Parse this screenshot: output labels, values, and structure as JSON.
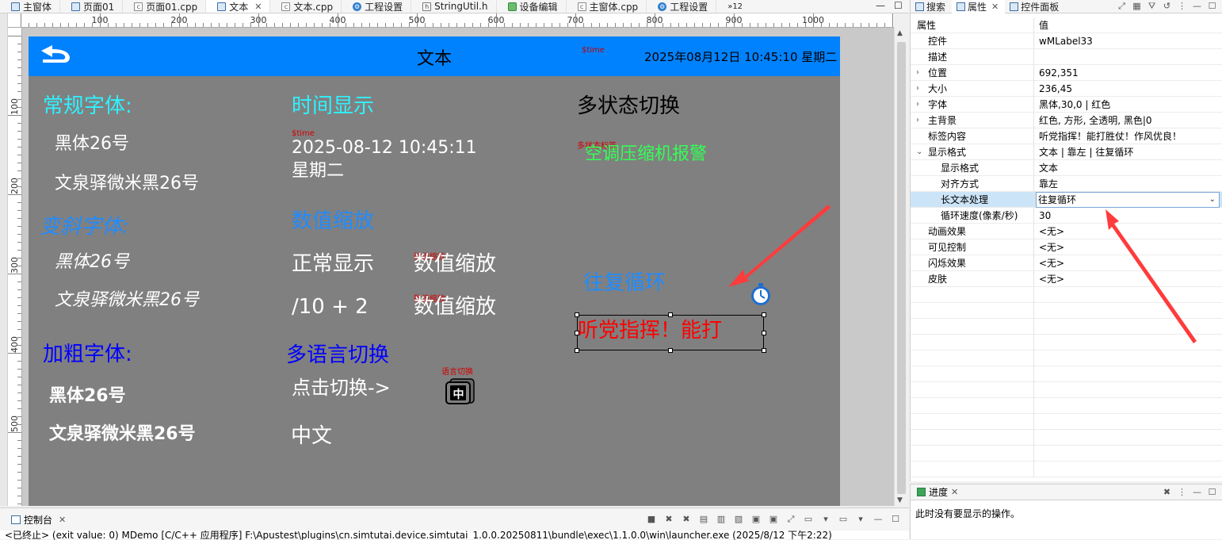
{
  "editor_tabs": [
    {
      "label": "主窗体",
      "icon": "window-icon"
    },
    {
      "label": "页面01",
      "icon": "window-icon"
    },
    {
      "label": "页面01.cpp",
      "icon": "cpp-file-icon"
    },
    {
      "label": "文本",
      "icon": "window-icon",
      "active": true
    },
    {
      "label": "文本.cpp",
      "icon": "cpp-file-icon"
    },
    {
      "label": "工程设置",
      "icon": "gear-icon"
    },
    {
      "label": "StringUtil.h",
      "icon": "header-file-icon"
    },
    {
      "label": "设备编辑",
      "icon": "device-icon"
    },
    {
      "label": "主窗体.cpp",
      "icon": "cpp-file-icon"
    },
    {
      "label": "工程设置",
      "icon": "gear-icon"
    }
  ],
  "tab_overflow": "»12",
  "ruler": {
    "h_labels": [
      "100",
      "200",
      "300",
      "400",
      "500",
      "600",
      "700",
      "800",
      "900",
      "1000"
    ],
    "v_labels": [
      "100",
      "200",
      "300",
      "400",
      "500"
    ]
  },
  "screen": {
    "title": "文本",
    "time_tag": "$time",
    "clock": "2025年08月12日 10:45:10 星期二",
    "col1": {
      "regular_heading": "常规字体:",
      "regular_1": "黑体26号",
      "regular_2": "文泉驿微米黑26号",
      "italic_heading": "变斜字体:",
      "italic_1": "黑体26号",
      "italic_2": "文泉驿微米黑26号",
      "bold_heading": "加粗字体:",
      "bold_1": "黑体26号",
      "bold_2": "文泉驿微米黑26号"
    },
    "col2": {
      "time_heading": "时间显示",
      "time_tag": "$time",
      "date_line": "2025-08-12 10:45:11",
      "weekday_line": "星期二",
      "scale_heading": "数值缩放",
      "normal_label": "正常显示",
      "scale_tag_1": "数值缩放",
      "scale_value_1": "数值缩放",
      "formula_label": "/10 + 2",
      "scale_tag_2": "数值缩放",
      "scale_value_2": "数值缩放",
      "lang_heading": "多语言切换",
      "click_label": "点击切换->",
      "lang_tag": "语言切换",
      "lang_button_text": "中",
      "lang_current": "中文"
    },
    "col3": {
      "multistate_heading": "多状态切换",
      "multistate_tag": "多状态标签",
      "alarm_text": "空调压缩机报警",
      "loop_heading": "往复循环",
      "scroll_label_text": "听党指挥！能打"
    }
  },
  "properties": {
    "tabs": [
      {
        "label": "搜索",
        "icon": "search-icon"
      },
      {
        "label": "属性",
        "icon": "properties-icon",
        "active": true
      },
      {
        "label": "控件面板",
        "icon": "palette-icon"
      }
    ],
    "header_key": "属性",
    "header_value": "值",
    "rows": [
      {
        "key": "控件",
        "value": "wMLabel33"
      },
      {
        "key": "描述",
        "value": ""
      },
      {
        "key": "位置",
        "value": "692,351",
        "expand": "›"
      },
      {
        "key": "大小",
        "value": "236,45",
        "expand": "›"
      },
      {
        "key": "字体",
        "value": "黑体,30,0 | 红色",
        "expand": "›"
      },
      {
        "key": "主背景",
        "value": "红色, 方形, 全透明, 黑色|0",
        "expand": "›"
      },
      {
        "key": "标签内容",
        "value": "听党指挥！能打胜仗！作风优良！"
      },
      {
        "key": "显示格式",
        "value": "文本 | 靠左 | 往复循环",
        "expand": "⌄"
      },
      {
        "key": "显示格式",
        "value": "文本",
        "level": 1
      },
      {
        "key": "对齐方式",
        "value": "靠左",
        "level": 1
      },
      {
        "key": "长文本处理",
        "value": "往复循环",
        "level": 1,
        "selected": true
      },
      {
        "key": "循环速度(像素/秒)",
        "value": "30",
        "level": 1
      },
      {
        "key": "动画效果",
        "value": "<无>"
      },
      {
        "key": "可见控制",
        "value": "<无>"
      },
      {
        "key": "闪烁效果",
        "value": "<无>"
      },
      {
        "key": "皮肤",
        "value": "<无>"
      }
    ]
  },
  "progress": {
    "tab_label": "进度",
    "message": "此时没有要显示的操作。"
  },
  "console": {
    "tab_label": "控制台",
    "line": "<已终止> (exit value: 0) MDemo [C/C++ 应用程序] F:\\Apustest\\plugins\\cn.simtutai.device.simtutai_1.0.0.20250811\\bundle\\exec\\1.1.0.0\\win\\launcher.exe (2025/8/12 下午2:22)"
  },
  "colors": {
    "title_bar": "#0082ff",
    "screen_bg": "#808080",
    "annotation_arrow": "#ff3b3b"
  }
}
